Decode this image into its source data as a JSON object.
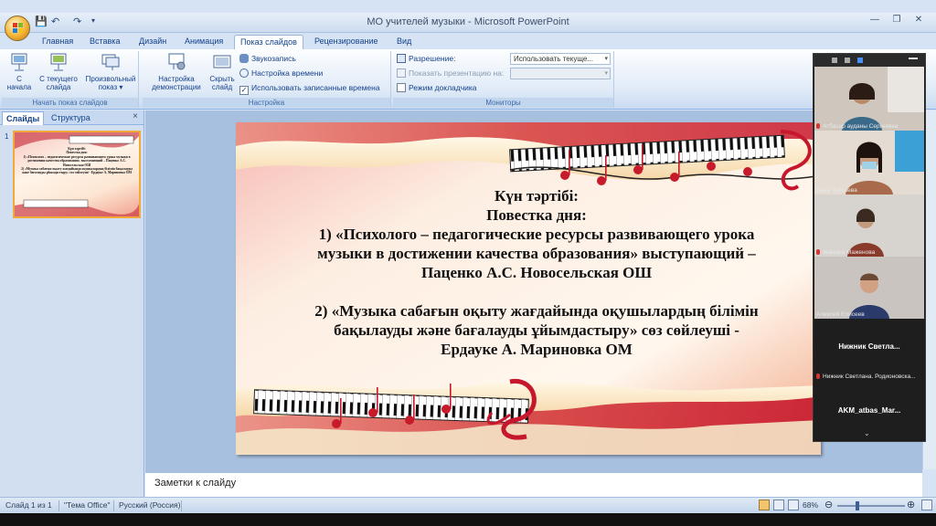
{
  "window": {
    "title": "МО учителей музыки - Microsoft PowerPoint",
    "qat_save": "💾",
    "qat_undo": "↶",
    "qat_redo": "↷"
  },
  "ribbon_tabs": [
    "Главная",
    "Вставка",
    "Дизайн",
    "Анимация",
    "Показ слайдов",
    "Рецензирование",
    "Вид"
  ],
  "ribbon": {
    "start_group": {
      "label": "Начать показ слайдов",
      "from_start": "С\nначала",
      "from_current": "С текущего\nслайда",
      "custom_show": "Произвольный\nпоказ ▾"
    },
    "setup_group": {
      "label": "Настройка",
      "setup_show": "Настройка\nдемонстрации",
      "hide_slide": "Скрыть\nслайд",
      "record_narration": "Звукозапись",
      "rehearse": "Настройка времени",
      "use_timings": "Использовать записанные времена"
    },
    "monitors_group": {
      "label": "Мониторы",
      "resolution_label": "Разрешение:",
      "resolution_value": "Использовать текуще...",
      "show_on_label": "Показать презентацию на:",
      "show_on_value": "",
      "presenter_view": "Режим докладчика"
    }
  },
  "left_pane": {
    "tab_slides": "Слайды",
    "tab_outline": "Структура",
    "close": "×",
    "slide_number": "1",
    "thumb_text": "Күн тәртібі:\nПовестка дня:\n1) «Психолого – педагогические ресурсы развивающего урока музыки в достижении качества образования» выступающий – Паценко А.С. Новосельская ОШ\n2) «Музыка сабағын оқыту жағдайында оқушылардың білімін бақылауды және бағалауды ұйымдастыру» сөз сөйлеуші - Ердауке А. Мариновка ОМ"
  },
  "slide": {
    "lines": [
      "Күн тәртібі:",
      "Повестка дня:",
      "1) «Психолого – педагогические ресурсы развивающего урока",
      "музыки в достижении качества образования» выступающий –",
      "Паценко А.С. Новосельская ОШ",
      "",
      "2) «Музыка сабағын оқыту жағдайында оқушылардың білімін",
      "бақылауды және бағалауды ұйымдастыру» сөз сөйлеуші  -",
      "Ердауке А. Мариновка ОМ"
    ]
  },
  "notes": {
    "placeholder": "Заметки к слайду"
  },
  "status": {
    "slide_of": "Слайд 1 из 1",
    "theme": "\"Тема Office\"",
    "language": "Русский (Россия)",
    "zoom": "68%"
  },
  "video_panel": {
    "participants": [
      {
        "name": "Атбасар ауданы Сергеевка",
        "has_video": true
      },
      {
        "name": "Дана Туйкаева",
        "has_video": true
      },
      {
        "name": "Жанара Маженова",
        "has_video": true
      },
      {
        "name": "Алексей Елисеев",
        "has_video": true
      },
      {
        "name": "Нижник Светлана. Родионовска...",
        "label": "Нижник  Светла...",
        "has_video": false
      },
      {
        "name": "",
        "label": "AKM_atbas_Mar...",
        "has_video": false
      }
    ]
  },
  "colors": {
    "ribbon_text": "#15428b",
    "accent_orange": "#f2a93b",
    "slide_red": "#d0142a"
  }
}
